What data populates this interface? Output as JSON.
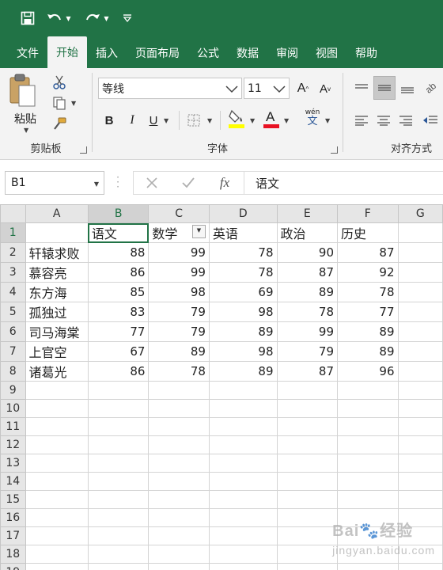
{
  "quick_access": {
    "save": "save-icon",
    "undo": "undo-icon",
    "redo": "redo-icon",
    "customize": "customize-icon"
  },
  "tabs": [
    {
      "label": "文件",
      "active": false
    },
    {
      "label": "开始",
      "active": true
    },
    {
      "label": "插入",
      "active": false
    },
    {
      "label": "页面布局",
      "active": false
    },
    {
      "label": "公式",
      "active": false
    },
    {
      "label": "数据",
      "active": false
    },
    {
      "label": "审阅",
      "active": false
    },
    {
      "label": "视图",
      "active": false
    },
    {
      "label": "帮助",
      "active": false
    }
  ],
  "ribbon": {
    "clipboard": {
      "label": "剪贴板",
      "paste_label": "粘贴"
    },
    "font": {
      "label": "字体",
      "font_name": "等线",
      "font_size": "11",
      "bold": "B",
      "italic": "I",
      "underline": "U",
      "phonetic_top": "wén",
      "phonetic_bottom": "文"
    },
    "alignment": {
      "label": "对齐方式"
    }
  },
  "formula_bar": {
    "name_box": "B1",
    "formula": "语文"
  },
  "sheet": {
    "columns": [
      "A",
      "B",
      "C",
      "D",
      "E",
      "F",
      "G"
    ],
    "selected_column": "B",
    "selected_row": 1,
    "rows": [
      [
        "",
        "语文",
        "数学",
        "英语",
        "政治",
        "历史"
      ],
      [
        "轩辕求败",
        "88",
        "99",
        "78",
        "90",
        "87"
      ],
      [
        "慕容亮",
        "86",
        "99",
        "78",
        "87",
        "92"
      ],
      [
        "东方海",
        "85",
        "98",
        "69",
        "89",
        "78"
      ],
      [
        "孤独过",
        "83",
        "79",
        "98",
        "78",
        "77"
      ],
      [
        "司马海棠",
        "77",
        "79",
        "89",
        "99",
        "89"
      ],
      [
        "上官空",
        "67",
        "89",
        "98",
        "79",
        "89"
      ],
      [
        "诸葛光",
        "86",
        "78",
        "89",
        "87",
        "96"
      ]
    ],
    "total_rows": 19
  },
  "colors": {
    "brand": "#217346",
    "ribbon_bg": "#f3f3f3",
    "header_bg": "#e6e6e6"
  },
  "watermark": {
    "brand": "Bai",
    "paw": "🐾",
    "suffix": "经验",
    "url": "jingyan.baidu.com"
  }
}
